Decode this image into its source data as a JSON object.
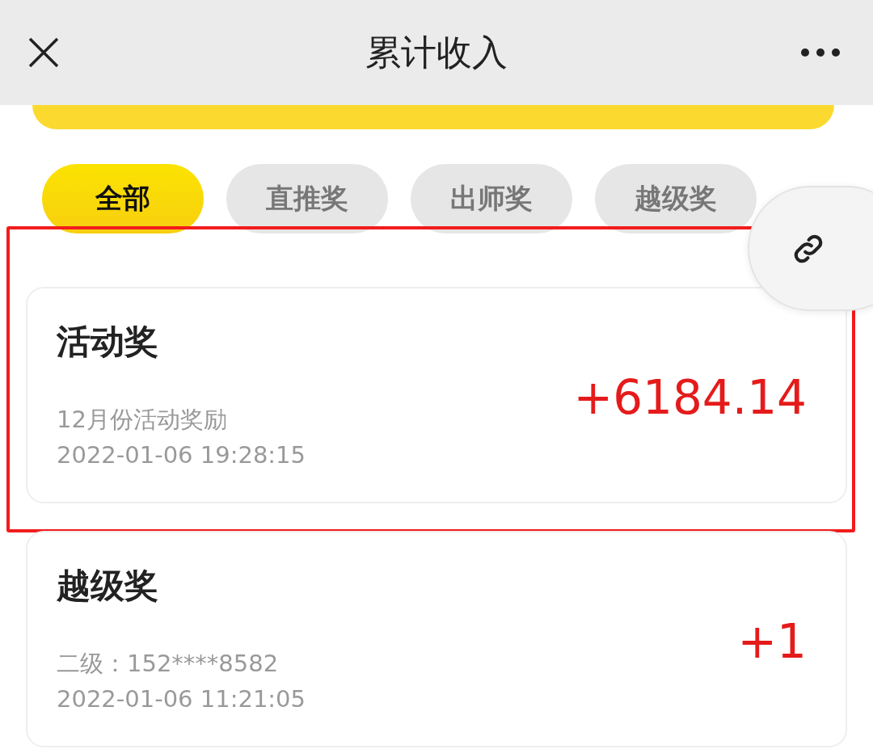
{
  "header": {
    "title": "累计收入"
  },
  "tabs": [
    {
      "label": "全部",
      "selected": true
    },
    {
      "label": "直推奖",
      "selected": false
    },
    {
      "label": "出师奖",
      "selected": false
    },
    {
      "label": "越级奖",
      "selected": false
    }
  ],
  "records": [
    {
      "title": "活动奖",
      "description": "12月份活动奖励",
      "time": "2022-01-06 19:28:15",
      "amount": "+6184.14",
      "highlighted": true
    },
    {
      "title": "越级奖",
      "description": "二级：152****8582",
      "time": "2022-01-06 11:21:05",
      "amount": "+1",
      "highlighted": false
    }
  ]
}
